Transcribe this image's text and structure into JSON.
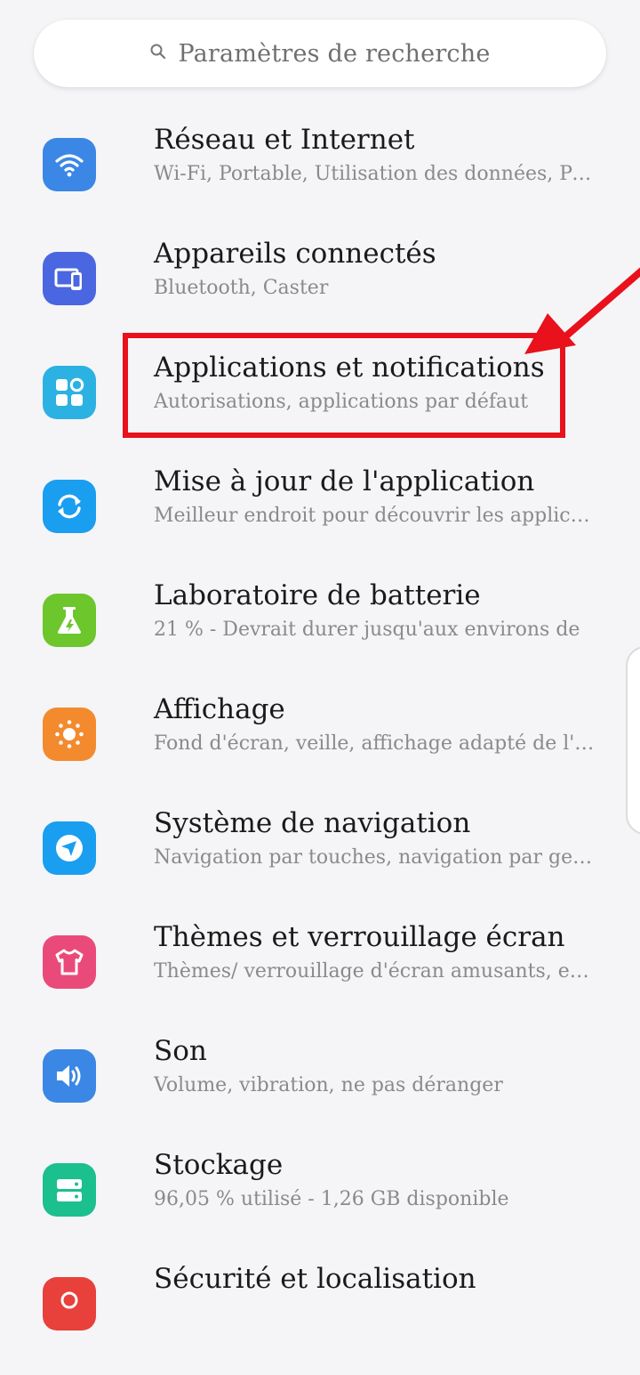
{
  "search": {
    "placeholder": "Paramètres de recherche",
    "icon": "search-icon"
  },
  "settings": [
    {
      "title": "Réseau et Internet",
      "subtitle": "Wi-Fi, Portable, Utilisation des données, Point d'accès",
      "icon": "wifi-icon",
      "color": "#3a87e6"
    },
    {
      "title": "Appareils connectés",
      "subtitle": "Bluetooth, Caster",
      "icon": "connected-devices-icon",
      "color": "#4a66e0"
    },
    {
      "title": "Applications et notifications",
      "subtitle": "Autorisations, applications par défaut",
      "icon": "apps-icon",
      "color": "#2cb1e3"
    },
    {
      "title": "Mise à jour de l'application",
      "subtitle": "Meilleur endroit pour découvrir les applications",
      "icon": "refresh-icon",
      "color": "#1a9ef0"
    },
    {
      "title": "Laboratoire de batterie",
      "subtitle": "21   % - Devrait durer jusqu'aux environs de",
      "icon": "flask-icon",
      "color": "#6cc62c"
    },
    {
      "title": "Affichage",
      "subtitle": "Fond d'écran, veille, affichage adapté de l'écran",
      "icon": "brightness-icon",
      "color": "#f38a2e"
    },
    {
      "title": "Système de navigation",
      "subtitle": "Navigation par touches, navigation par gestes",
      "icon": "navigation-icon",
      "color": "#1a9ef0"
    },
    {
      "title": "Thèmes et verrouillage écran",
      "subtitle": "Thèmes/ verrouillage d'écran amusants, et plus",
      "icon": "tshirt-icon",
      "color": "#ea4a7a"
    },
    {
      "title": "Son",
      "subtitle": "Volume, vibration, ne pas déranger",
      "icon": "speaker-icon",
      "color": "#3a87e6"
    },
    {
      "title": "Stockage",
      "subtitle": "96,05    % utilisé - 1,26    GB disponible",
      "icon": "storage-icon",
      "color": "#1cbf8e"
    },
    {
      "title": "Sécurité et localisation",
      "subtitle": "",
      "icon": "security-icon",
      "color": "#e8403a"
    }
  ],
  "annotation": {
    "highlight_color": "#e8111c",
    "highlighted_item": "Applications et notifications"
  }
}
